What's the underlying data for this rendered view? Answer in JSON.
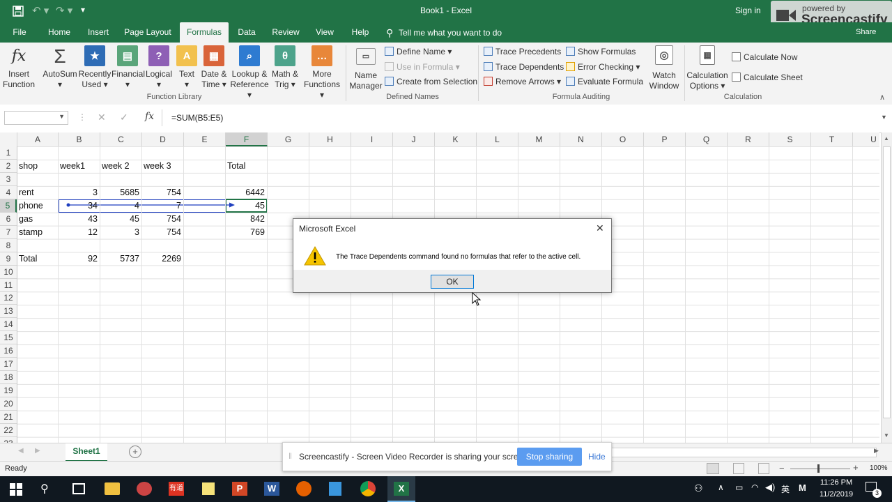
{
  "window": {
    "title": "Book1  -  Excel",
    "sign_in": "Sign in",
    "share": "Share",
    "overlay_brand_top": "powered by",
    "overlay_brand": "Screencastify"
  },
  "ribbon_tabs": [
    "File",
    "Home",
    "Insert",
    "Page Layout",
    "Formulas",
    "Data",
    "Review",
    "View",
    "Help"
  ],
  "tell_me": "Tell me what you want to do",
  "ribbon": {
    "function_library": {
      "label": "Function Library",
      "buttons": [
        {
          "l1": "Insert",
          "l2": "Function"
        },
        {
          "l1": "AutoSum",
          "l2": "▾"
        },
        {
          "l1": "Recently",
          "l2": "Used ▾"
        },
        {
          "l1": "Financial",
          "l2": "▾"
        },
        {
          "l1": "Logical",
          "l2": "▾"
        },
        {
          "l1": "Text",
          "l2": "▾"
        },
        {
          "l1": "Date &",
          "l2": "Time ▾"
        },
        {
          "l1": "Lookup &",
          "l2": "Reference ▾"
        },
        {
          "l1": "Math &",
          "l2": "Trig ▾"
        },
        {
          "l1": "More",
          "l2": "Functions ▾"
        }
      ]
    },
    "defined_names": {
      "label": "Defined Names",
      "name_manager": {
        "l1": "Name",
        "l2": "Manager"
      },
      "define_name": "Define Name ▾",
      "use_in_formula": "Use in Formula ▾",
      "create_from_selection": "Create from Selection"
    },
    "formula_auditing": {
      "label": "Formula Auditing",
      "trace_precedents": "Trace Precedents",
      "trace_dependents": "Trace Dependents",
      "remove_arrows": "Remove Arrows ▾",
      "show_formulas": "Show Formulas",
      "error_checking": "Error Checking ▾",
      "evaluate_formula": "Evaluate Formula",
      "watch_window": {
        "l1": "Watch",
        "l2": "Window"
      }
    },
    "calculation": {
      "label": "Calculation",
      "options": {
        "l1": "Calculation",
        "l2": "Options ▾"
      },
      "calc_now": "Calculate Now",
      "calc_sheet": "Calculate Sheet"
    }
  },
  "formula_bar": {
    "name_box": "",
    "fx": "fx",
    "formula": "=SUM(B5:E5)"
  },
  "columns": [
    "A",
    "B",
    "C",
    "D",
    "E",
    "F",
    "G",
    "H",
    "I",
    "J",
    "K",
    "L",
    "M",
    "N",
    "O",
    "P",
    "Q",
    "R",
    "S",
    "T",
    "U"
  ],
  "rows": [
    "1",
    "2",
    "3",
    "4",
    "5",
    "6",
    "7",
    "8",
    "9",
    "10",
    "11",
    "12",
    "13",
    "14",
    "15",
    "16",
    "17",
    "18",
    "19",
    "20",
    "21",
    "22",
    "23"
  ],
  "cells": {
    "A2": "shop",
    "B2": "week1",
    "C2": "week 2",
    "D2": "week 3",
    "F2": "Total",
    "A4": "rent",
    "B4": "3",
    "C4": "5685",
    "D4": "754",
    "F4": "6442",
    "A5": "phone",
    "B5": "34",
    "C5": "4",
    "D5": "7",
    "F5": "45",
    "A6": "gas",
    "B6": "43",
    "C6": "45",
    "D6": "754",
    "F6": "842",
    "A7": "stamp",
    "B7": "12",
    "C7": "3",
    "D7": "754",
    "F7": "769",
    "A9": "Total",
    "B9": "92",
    "C9": "5737",
    "D9": "2269"
  },
  "dialog": {
    "title": "Microsoft Excel",
    "message": "The Trace Dependents command found no formulas that refer to the active cell.",
    "ok": "OK"
  },
  "sheet_tab": "Sheet1",
  "status": {
    "ready": "Ready",
    "zoom": "100%"
  },
  "sharebar": {
    "message": "Screencastify - Screen Video Recorder is sharing your screen.",
    "stop": "Stop sharing",
    "hide": "Hide"
  },
  "taskbar": {
    "time": "11:26 PM",
    "date": "11/2/2019",
    "ime": "英",
    "notif_count": "3"
  },
  "colors": {
    "excel_green": "#217346",
    "trace_arrow": "#1f3fbf",
    "selection": "#217346"
  }
}
